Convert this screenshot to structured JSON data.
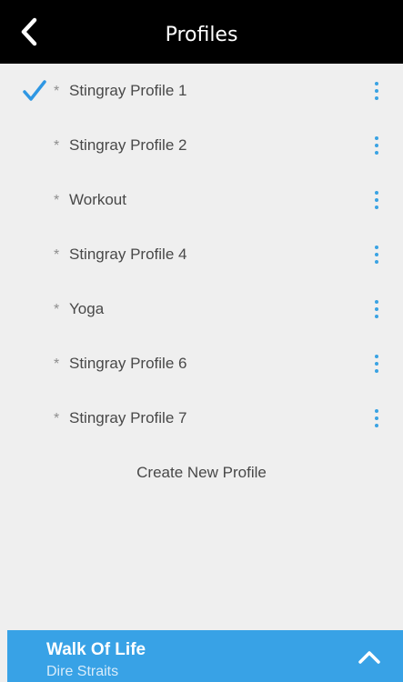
{
  "header": {
    "title": "Profiles",
    "back_icon": "chevron-left-icon"
  },
  "profiles": [
    {
      "name": "Stingray Profile 1",
      "selected": true
    },
    {
      "name": "Stingray Profile 2",
      "selected": false
    },
    {
      "name": "Workout",
      "selected": false
    },
    {
      "name": "Stingray Profile 4",
      "selected": false
    },
    {
      "name": "Yoga",
      "selected": false
    },
    {
      "name": "Stingray Profile 6",
      "selected": false
    },
    {
      "name": "Stingray Profile 7",
      "selected": false
    }
  ],
  "bullet": "*",
  "create_label": "Create New Profile",
  "now_playing": {
    "title": "Walk Of Life",
    "artist": "Dire Straits",
    "expand_icon": "chevron-up-icon"
  },
  "colors": {
    "accent": "#38a2e6",
    "header_bg": "#000000",
    "list_bg": "#efefef"
  }
}
